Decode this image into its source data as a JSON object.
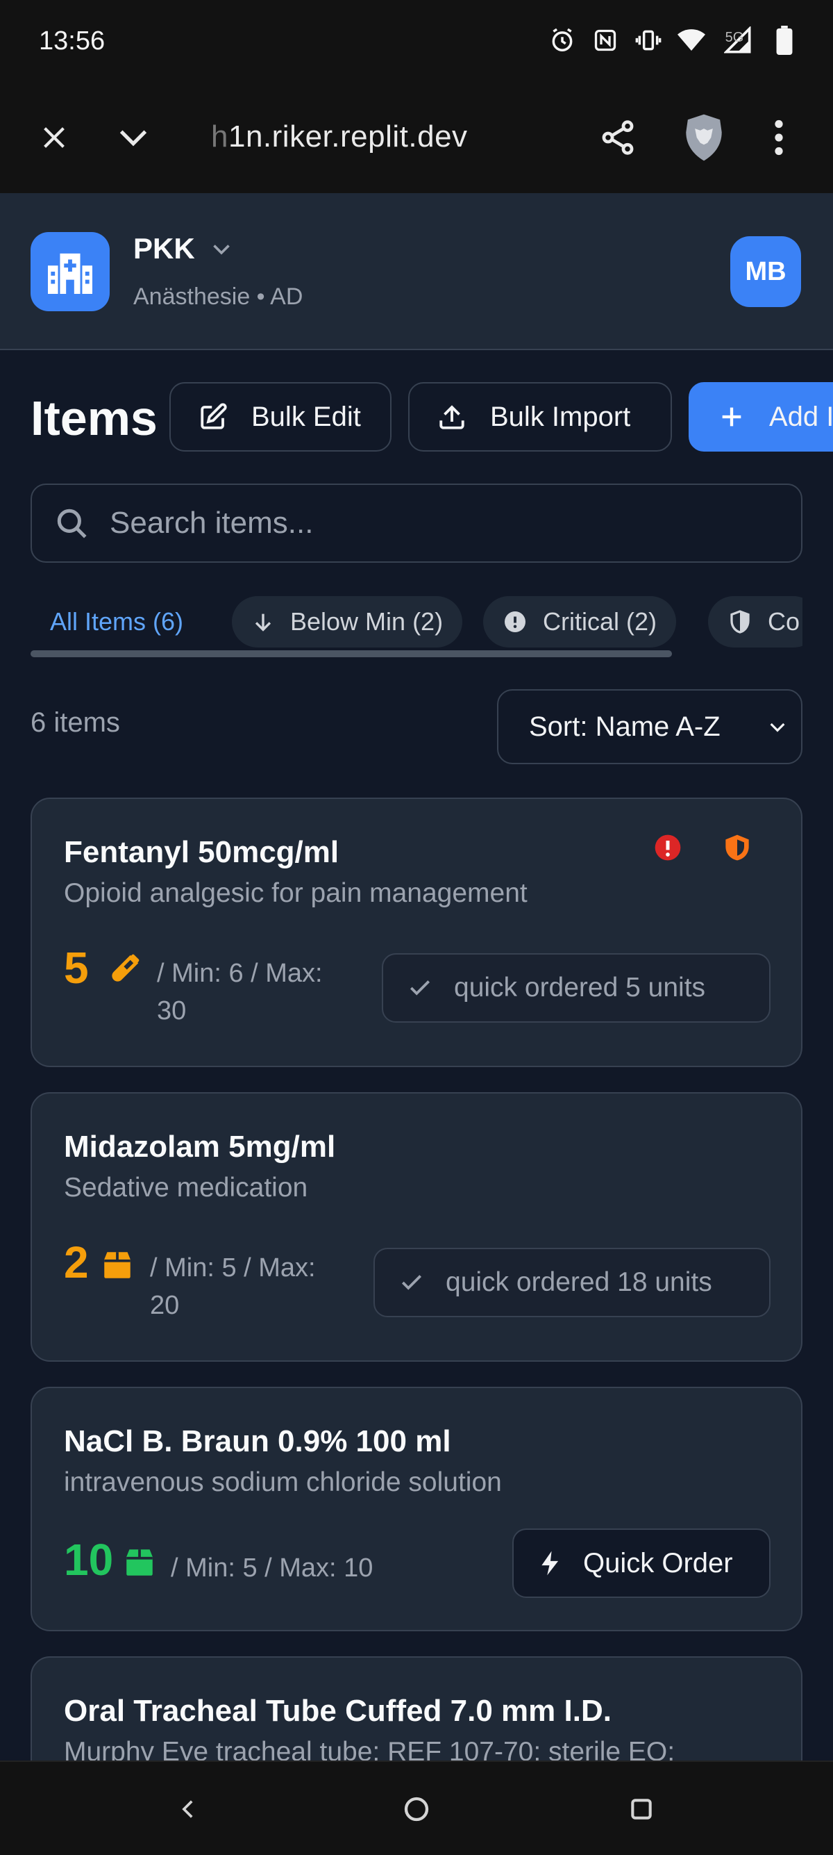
{
  "status_bar": {
    "time": "13:56",
    "icons": [
      "alarm-icon",
      "nfc-icon",
      "vibrate-icon",
      "wifi-icon",
      "signal-5g-icon",
      "battery-icon"
    ]
  },
  "browser": {
    "url_faded": "h",
    "url": "1n.riker.replit.dev"
  },
  "header": {
    "org_name": "PKK",
    "org_sub": "Anästhesie • AD",
    "avatar": "MB",
    "accent": "#3b82f6"
  },
  "page": {
    "title": "Items",
    "buttons": {
      "bulk_edit": "Bulk Edit",
      "bulk_import": "Bulk Import",
      "add": "Add I"
    },
    "search_placeholder": "Search items...",
    "filters": [
      {
        "label": "All Items (6)",
        "active": true
      },
      {
        "label": "Below Min (2)",
        "icon": "arrow-down-icon"
      },
      {
        "label": "Critical (2)",
        "icon": "alert-circle-icon"
      },
      {
        "label": "Co",
        "icon": "shield-icon"
      }
    ],
    "count": "6 items",
    "sort": "Sort: Name A-Z"
  },
  "items": [
    {
      "name": "Fentanyl 50mcg/ml",
      "description": "Opioid analgesic for pain management",
      "quantity": "5",
      "quantity_color": "#f59e0b",
      "unit_icon": "vial-icon",
      "minmax_line1": "/ Min: 6 / Max:",
      "minmax_line2": "30",
      "status": "quick ordered 5 units",
      "badges": [
        "critical-icon",
        "controlled-shield-icon"
      ]
    },
    {
      "name": "Midazolam 5mg/ml",
      "description": "Sedative medication",
      "quantity": "2",
      "quantity_color": "#f59e0b",
      "unit_icon": "package-icon",
      "minmax_line1": "/ Min: 5 / Max:",
      "minmax_line2": "20",
      "status": "quick ordered 18 units"
    },
    {
      "name": "NaCl B. Braun 0.9% 100 ml",
      "description": "intravenous sodium chloride solution",
      "quantity": "10",
      "quantity_color": "#22c55e",
      "unit_icon": "package-icon",
      "minmax_line1": "/ Min: 5 / Max: 10",
      "action": "Quick Order"
    },
    {
      "name": "Oral Tracheal Tube Cuffed 7.0 mm I.D.",
      "description": "Murphy Eye tracheal tube; REF 107-70; sterile EO;"
    }
  ]
}
